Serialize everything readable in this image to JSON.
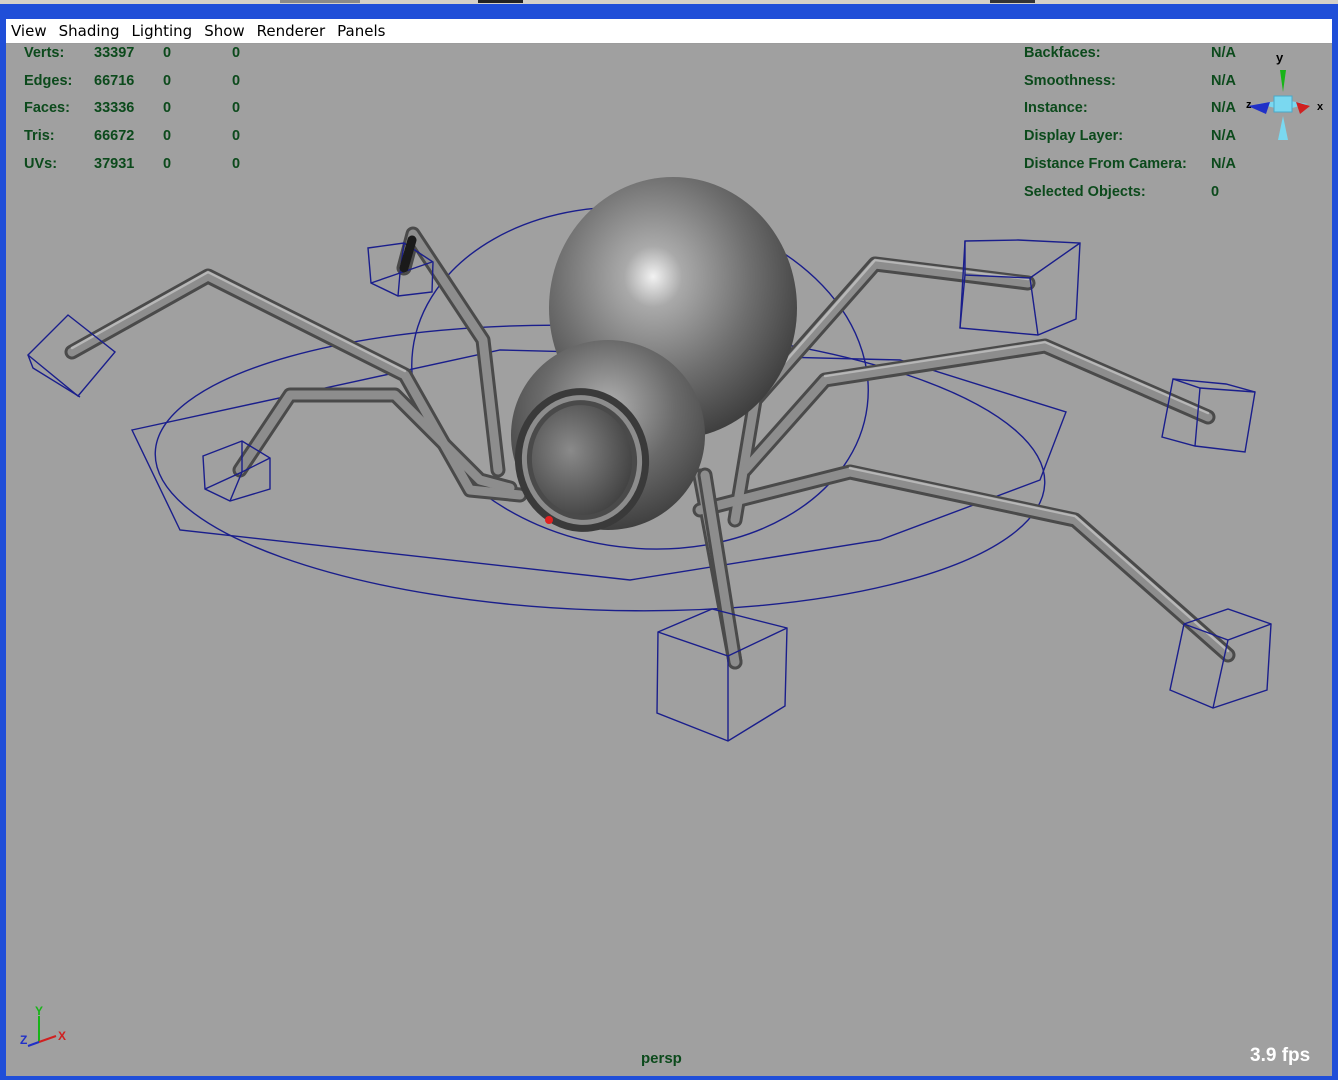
{
  "menu": [
    "View",
    "Shading",
    "Lighting",
    "Show",
    "Renderer",
    "Panels"
  ],
  "stats": [
    {
      "label": "Verts:",
      "value": "33397",
      "c2": "0",
      "c3": "0"
    },
    {
      "label": "Edges:",
      "value": "66716",
      "c2": "0",
      "c3": "0"
    },
    {
      "label": "Faces:",
      "value": "33336",
      "c2": "0",
      "c3": "0"
    },
    {
      "label": "Tris:",
      "value": "66672",
      "c2": "0",
      "c3": "0"
    },
    {
      "label": "UVs:",
      "value": "37931",
      "c2": "0",
      "c3": "0"
    }
  ],
  "info": [
    {
      "label": "Backfaces:",
      "value": "N/A"
    },
    {
      "label": "Smoothness:",
      "value": "N/A"
    },
    {
      "label": "Instance:",
      "value": "N/A"
    },
    {
      "label": "Display Layer:",
      "value": "N/A"
    },
    {
      "label": "Distance From Camera:",
      "value": "N/A"
    },
    {
      "label": "Selected Objects:",
      "value": "0"
    }
  ],
  "view_cube": {
    "y": "y",
    "x": "x",
    "z": "z"
  },
  "axis": {
    "y": "Y",
    "x": "X",
    "z": "Z"
  },
  "camera": "persp",
  "fps": "3.9 fps",
  "colors": {
    "viewport_bg": "#a0a0a0",
    "hud_text": "#0c4a1c",
    "frame": "#1f4ed8",
    "wireframe": "#1a1e8c",
    "model": "#6e6e6e"
  }
}
